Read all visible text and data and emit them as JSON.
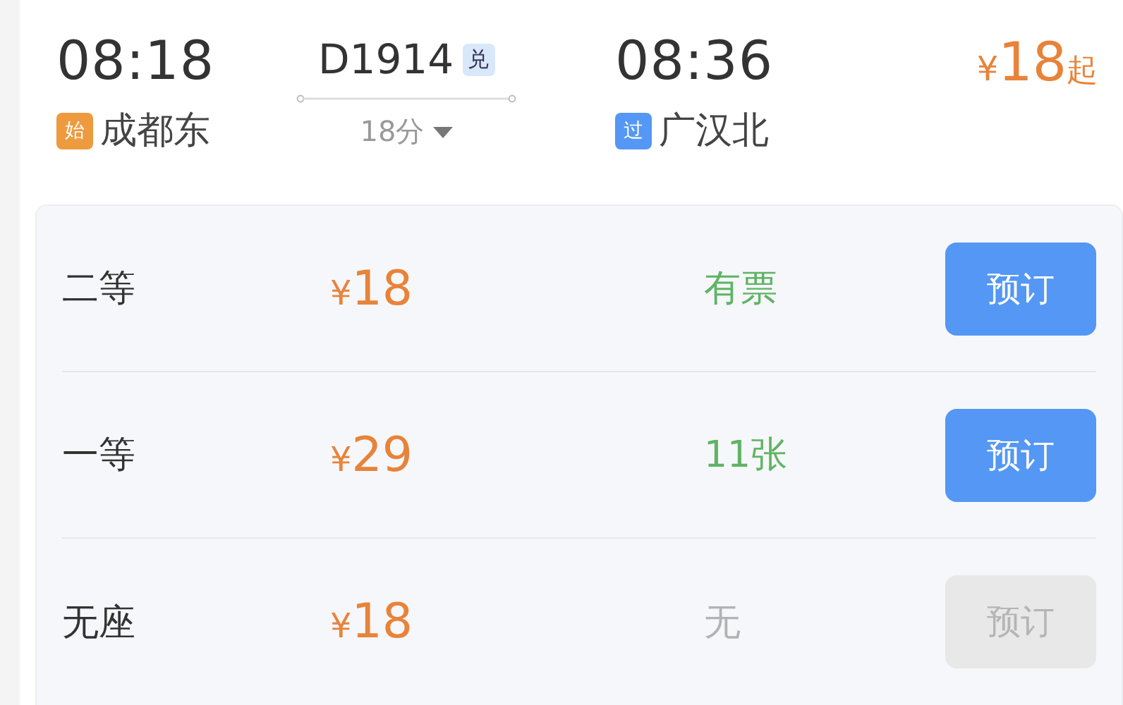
{
  "train": {
    "depart_time": "08:18",
    "depart_station": {
      "tag": "始",
      "kind": "start",
      "name": "成都东"
    },
    "number": "D1914",
    "badge": "兑",
    "duration": "18分",
    "expanded": false,
    "arrive_time": "08:36",
    "arrive_station": {
      "tag": "过",
      "kind": "pass",
      "name": "广汉北"
    },
    "min_price": {
      "currency": "¥",
      "amount": "18",
      "suffix": "起"
    }
  },
  "seats": [
    {
      "name": "二等",
      "currency": "¥",
      "price": "18",
      "availability": "有票",
      "available": true,
      "button": "预订",
      "disabled": false
    },
    {
      "name": "一等",
      "currency": "¥",
      "price": "29",
      "availability": "11张",
      "available": true,
      "button": "预订",
      "disabled": false
    },
    {
      "name": "无座",
      "currency": "¥",
      "price": "18",
      "availability": "无",
      "available": false,
      "button": "预订",
      "disabled": true
    }
  ]
}
